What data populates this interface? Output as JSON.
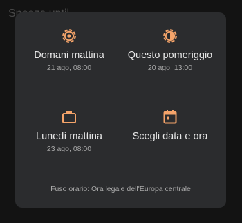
{
  "background": {
    "title": "Snooze until..."
  },
  "dialog": {
    "options": [
      {
        "label": "Domani mattina",
        "sub": "21 ago, 08:00",
        "icon": "sun-icon"
      },
      {
        "label": "Questo pomeriggio",
        "sub": "20 ago, 13:00",
        "icon": "half-sun-icon"
      },
      {
        "label": "Lunedì mattina",
        "sub": "23 ago, 08:00",
        "icon": "briefcase-icon"
      },
      {
        "label": "Scegli data e ora",
        "sub": "",
        "icon": "calendar-icon"
      }
    ],
    "timezone": "Fuso orario: Ora legale dell'Europa centrale"
  },
  "colors": {
    "accent": "#f5a46a",
    "dialog_bg": "#2b2c2e",
    "page_bg": "#131313"
  }
}
